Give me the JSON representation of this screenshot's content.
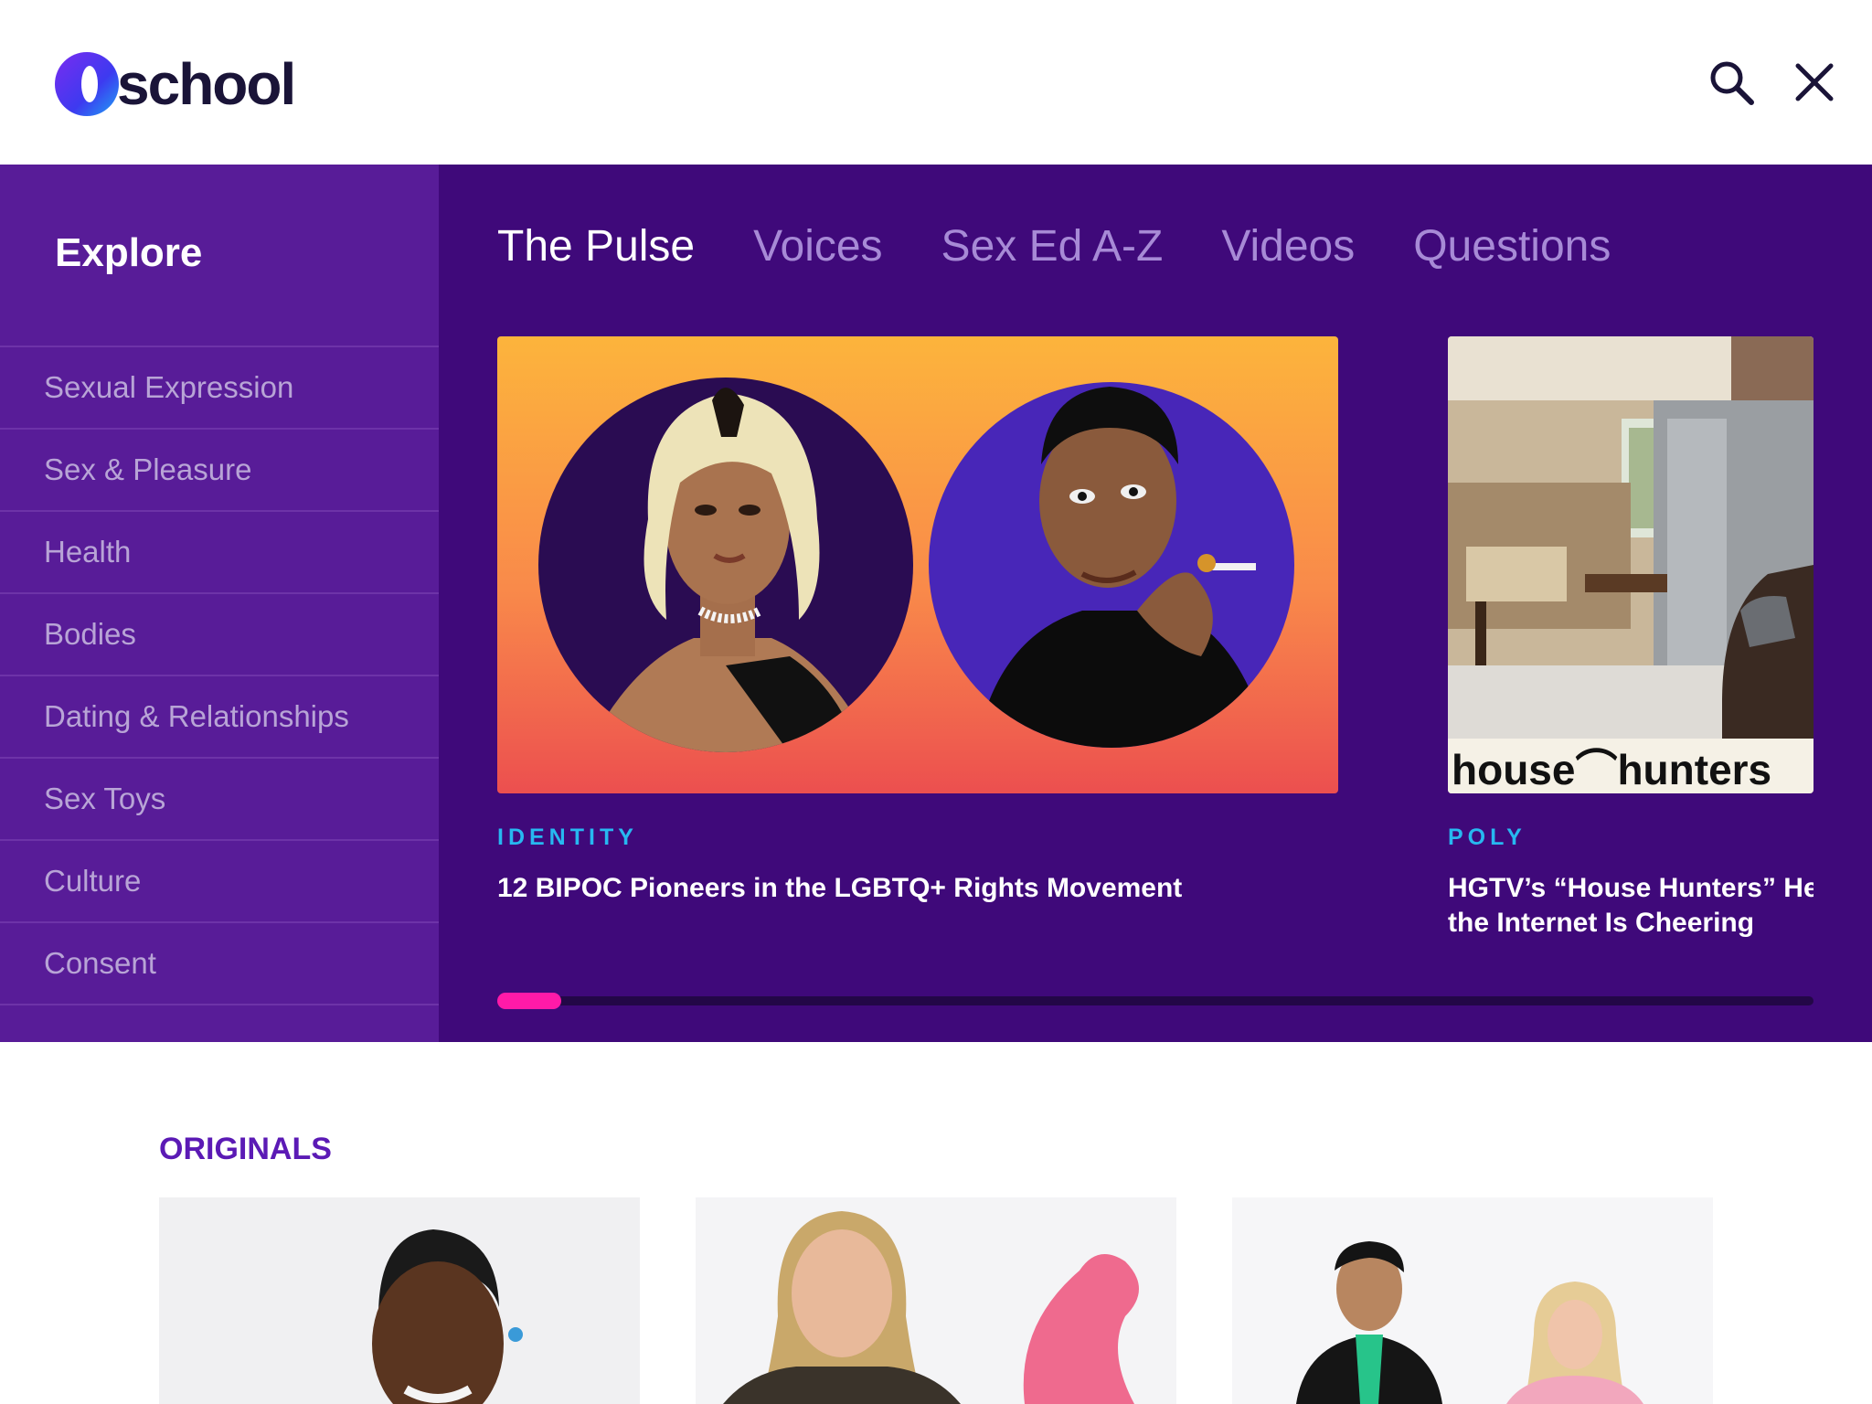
{
  "header": {
    "logo_text": "school",
    "search_icon": "search-icon",
    "close_icon": "close-icon"
  },
  "sidebar": {
    "title": "Explore",
    "items": [
      {
        "label": "Sexual Expression"
      },
      {
        "label": "Sex & Pleasure"
      },
      {
        "label": "Health"
      },
      {
        "label": "Bodies"
      },
      {
        "label": "Dating & Relationships"
      },
      {
        "label": "Sex Toys"
      },
      {
        "label": "Culture"
      },
      {
        "label": "Consent"
      }
    ]
  },
  "tabs": [
    {
      "label": "The Pulse",
      "active": true
    },
    {
      "label": "Voices",
      "active": false
    },
    {
      "label": "Sex Ed A-Z",
      "active": false
    },
    {
      "label": "Videos",
      "active": false
    },
    {
      "label": "Questions",
      "active": false
    }
  ],
  "cards": [
    {
      "category": "IDENTITY",
      "title": "12 BIPOC Pioneers in the LGBTQ+ Rights Movement"
    },
    {
      "category": "POLY",
      "title_line1": "HGTV’s “House Hunters” He",
      "title_line2": "the Internet Is Cheering",
      "overlay_text": "house hunters"
    }
  ],
  "originals": {
    "title": "ORIGINALS"
  },
  "colors": {
    "menu_bg": "#3f097a",
    "sidebar_bg": "#581c98",
    "accent_pink": "#ff1aa8",
    "category_blue": "#27b8f0",
    "originals_purple": "#5b1ab5"
  }
}
